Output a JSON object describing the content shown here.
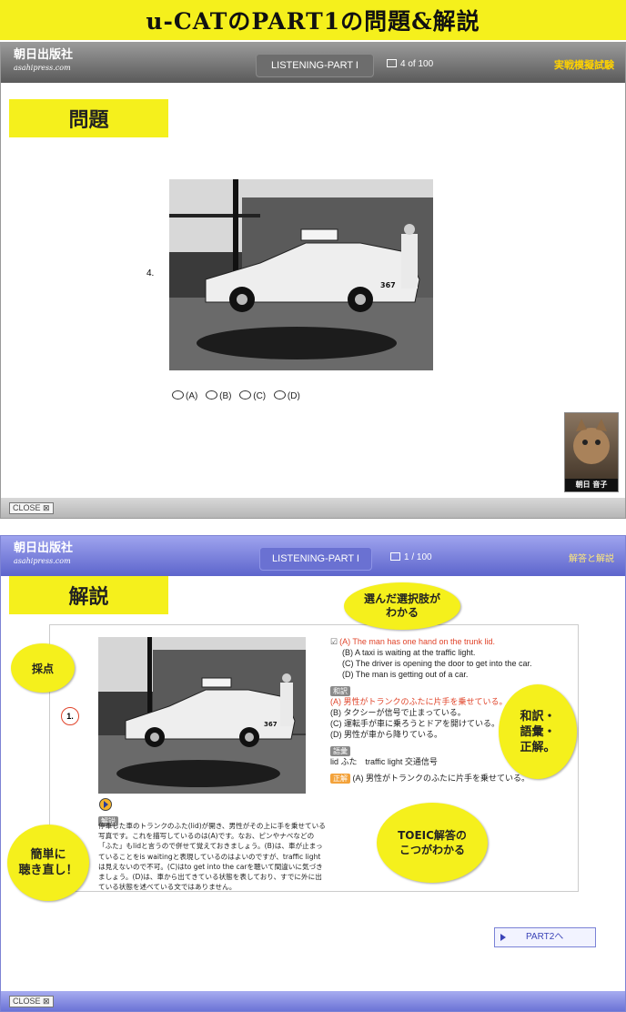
{
  "banner": {
    "title": "u-CATのPART1の問題&解説"
  },
  "screen1": {
    "logo": "朝日出版社",
    "logo_sub": "asahipress.com",
    "tab": "LISTENING-PART I",
    "counter": "4 of 100",
    "mode": "実戦模擬試験",
    "section_title": "問題",
    "question_number": "4.",
    "options": [
      "(A)",
      "(B)",
      "(C)",
      "(D)"
    ],
    "avatar_name": "朝日 音子",
    "close": "CLOSE ⊠",
    "photo_sign": "367"
  },
  "screen2": {
    "logo": "朝日出版社",
    "logo_sub": "asahipress.com",
    "tab": "LISTENING-PART I",
    "counter": "1 / 100",
    "mode": "解答と解説",
    "section_title": "解説",
    "question_number": "1.",
    "answers": [
      "(A) The man has one hand on the trunk lid.",
      "(B) A taxi is waiting at the traffic light.",
      "(C) The driver is opening the door to get into the car.",
      "(D) The man is getting out of a car."
    ],
    "translation_tag": "和訳",
    "translations": [
      "(A) 男性がトランクのふたに片手を乗せている。",
      "(B) タクシーが信号で止まっている。",
      "(C) 運転手が車に乗ろうとドアを開けている。",
      "(D) 男性が車から降りている。"
    ],
    "vocab_tag": "語彙",
    "vocab": "lid ふた　traffic light 交通信号",
    "correct_tag": "正解",
    "correct": "(A) 男性がトランクのふたに片手を乗せている。",
    "expl_tag": "解説",
    "explanation": "停車した車のトランクのふた(lid)が開き、男性がその上に手を乗せている写真です。これを描写しているのは(A)です。なお、ピンやナベなどの「ふた」もlidと言うので併せて覚えておきましょう。(B)は、車が止まっていることをis waitingと表現しているのはよいのですが、traffic lightは見えないので不可。(C)はto get into the carを聴いて間違いに気づきましょう。(D)は、車から出てきている状態を表しており、すでに外に出ている状態を述べている文ではありません。",
    "next_button": "PART2へ",
    "close": "CLOSE ⊠",
    "photo_sign": "367"
  },
  "callouts": {
    "choice": "選んだ選択肢が\nわかる",
    "score": "採点",
    "translation": "和訳・\n語彙・\n正解。",
    "replay": "簡単に\n聴き直し！",
    "toeic": "TOEIC解答の\nこつがわかる"
  },
  "colors": {
    "banner": "#f5f01c",
    "screen1_header": "#6d6d6d",
    "screen2_header": "#6a71d2",
    "highlight": "#e0442a"
  }
}
